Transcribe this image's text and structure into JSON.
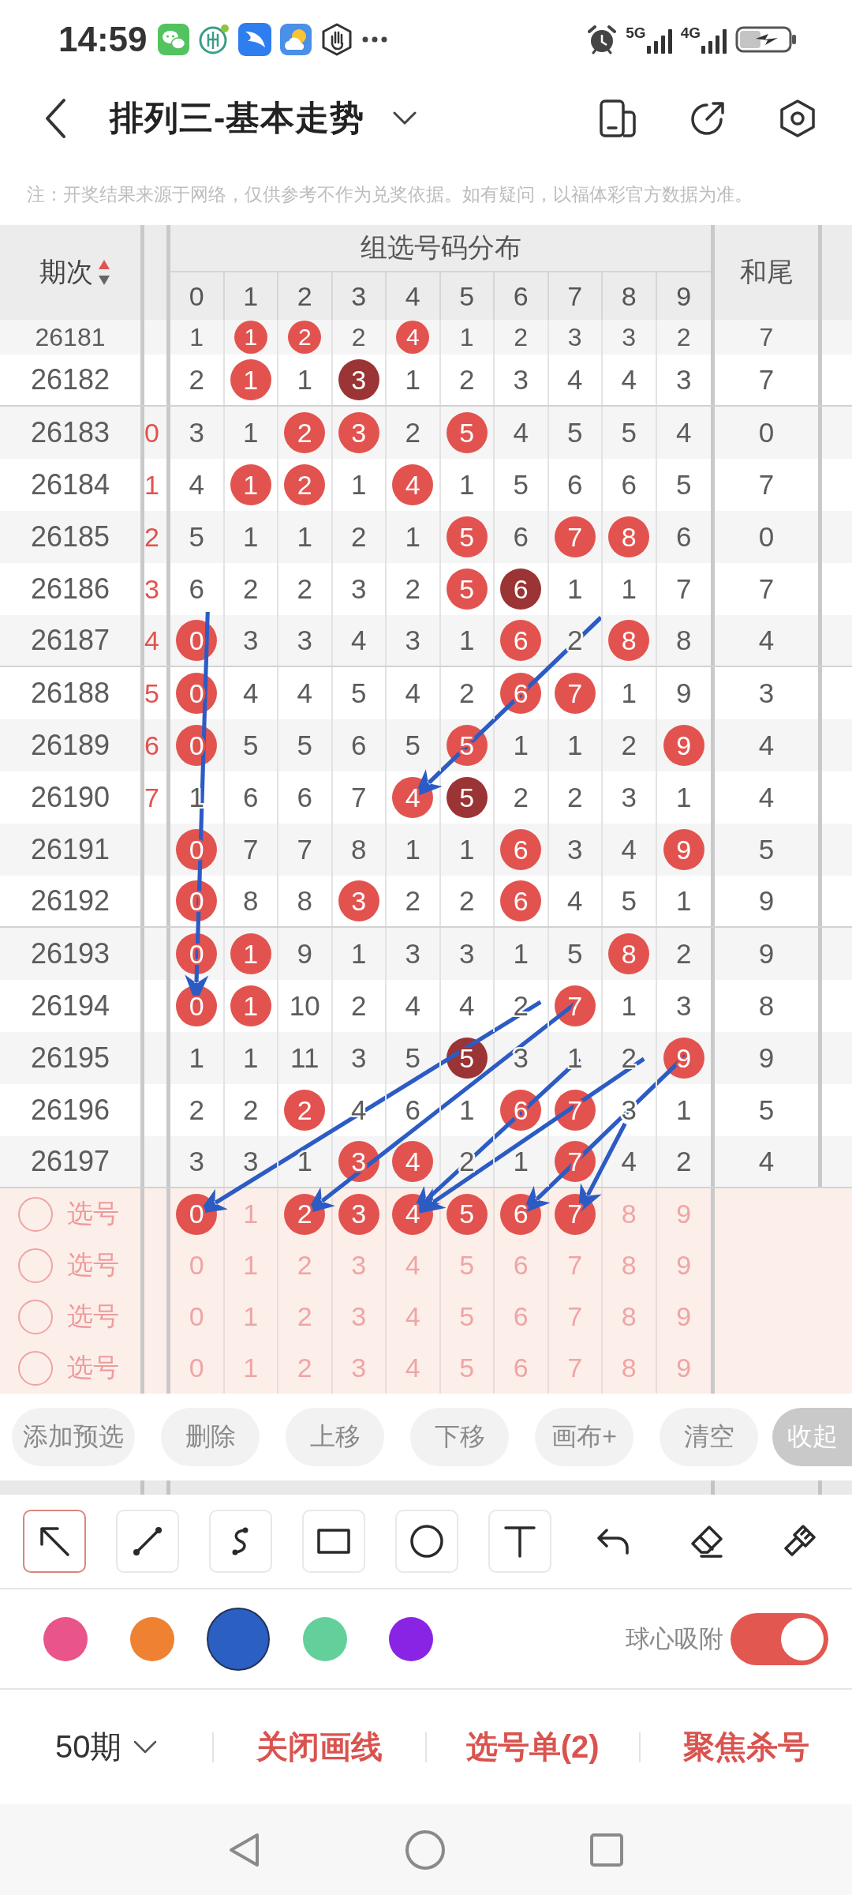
{
  "status_bar": {
    "time": "14:59",
    "networks": [
      "5G",
      "4G"
    ]
  },
  "header": {
    "title": "排列三-基本走势"
  },
  "notice": "注：开奖结果来源于网络，仅供参考不作为兑奖依据。如有疑问，以福体彩官方数据为准。",
  "table": {
    "period_header": "期次",
    "sort_ascending": true,
    "group_header": "组选号码分布",
    "digit_headers": [
      "0",
      "1",
      "2",
      "3",
      "4",
      "5",
      "6",
      "7",
      "8",
      "9"
    ],
    "tail_header": "和尾",
    "rows": [
      {
        "period": "26181",
        "cells": [
          {
            "text": "1",
            "kind": "plain"
          },
          {
            "text": "1",
            "kind": "ball"
          },
          {
            "text": "2",
            "kind": "ball"
          },
          {
            "text": "2",
            "kind": "plain"
          },
          {
            "text": "4",
            "kind": "ball"
          },
          {
            "text": "1",
            "kind": "plain"
          },
          {
            "text": "2",
            "kind": "plain"
          },
          {
            "text": "3",
            "kind": "plain"
          },
          {
            "text": "3",
            "kind": "plain"
          },
          {
            "text": "2",
            "kind": "plain"
          }
        ],
        "tail": "7"
      },
      {
        "period": "26182",
        "cells": [
          {
            "text": "2",
            "kind": "plain"
          },
          {
            "text": "1",
            "kind": "ball"
          },
          {
            "text": "1",
            "kind": "plain"
          },
          {
            "text": "3",
            "kind": "repeat"
          },
          {
            "text": "1",
            "kind": "plain"
          },
          {
            "text": "2",
            "kind": "plain"
          },
          {
            "text": "3",
            "kind": "plain"
          },
          {
            "text": "4",
            "kind": "plain"
          },
          {
            "text": "4",
            "kind": "plain"
          },
          {
            "text": "3",
            "kind": "plain"
          }
        ],
        "tail": "7"
      },
      {
        "period": "26183",
        "edge": "0",
        "cells": [
          {
            "text": "3",
            "kind": "plain"
          },
          {
            "text": "1",
            "kind": "plain"
          },
          {
            "text": "2",
            "kind": "ball"
          },
          {
            "text": "3",
            "kind": "ball"
          },
          {
            "text": "2",
            "kind": "plain"
          },
          {
            "text": "5",
            "kind": "ball"
          },
          {
            "text": "4",
            "kind": "plain"
          },
          {
            "text": "5",
            "kind": "plain"
          },
          {
            "text": "5",
            "kind": "plain"
          },
          {
            "text": "4",
            "kind": "plain"
          }
        ],
        "tail": "0"
      },
      {
        "period": "26184",
        "edge": "1",
        "cells": [
          {
            "text": "4",
            "kind": "plain"
          },
          {
            "text": "1",
            "kind": "ball"
          },
          {
            "text": "2",
            "kind": "ball"
          },
          {
            "text": "1",
            "kind": "plain"
          },
          {
            "text": "4",
            "kind": "ball"
          },
          {
            "text": "1",
            "kind": "plain"
          },
          {
            "text": "5",
            "kind": "plain"
          },
          {
            "text": "6",
            "kind": "plain"
          },
          {
            "text": "6",
            "kind": "plain"
          },
          {
            "text": "5",
            "kind": "plain"
          }
        ],
        "tail": "7"
      },
      {
        "period": "26185",
        "edge": "2",
        "cells": [
          {
            "text": "5",
            "kind": "plain"
          },
          {
            "text": "1",
            "kind": "plain"
          },
          {
            "text": "1",
            "kind": "plain"
          },
          {
            "text": "2",
            "kind": "plain"
          },
          {
            "text": "1",
            "kind": "plain"
          },
          {
            "text": "5",
            "kind": "ball"
          },
          {
            "text": "6",
            "kind": "plain"
          },
          {
            "text": "7",
            "kind": "ball"
          },
          {
            "text": "8",
            "kind": "ball"
          },
          {
            "text": "6",
            "kind": "plain"
          }
        ],
        "tail": "0"
      },
      {
        "period": "26186",
        "edge": "3",
        "cells": [
          {
            "text": "6",
            "kind": "plain"
          },
          {
            "text": "2",
            "kind": "plain"
          },
          {
            "text": "2",
            "kind": "plain"
          },
          {
            "text": "3",
            "kind": "plain"
          },
          {
            "text": "2",
            "kind": "plain"
          },
          {
            "text": "5",
            "kind": "ball"
          },
          {
            "text": "6",
            "kind": "repeat"
          },
          {
            "text": "1",
            "kind": "plain"
          },
          {
            "text": "1",
            "kind": "plain"
          },
          {
            "text": "7",
            "kind": "plain"
          }
        ],
        "tail": "7"
      },
      {
        "period": "26187",
        "edge": "4",
        "cells": [
          {
            "text": "0",
            "kind": "ball"
          },
          {
            "text": "3",
            "kind": "plain"
          },
          {
            "text": "3",
            "kind": "plain"
          },
          {
            "text": "4",
            "kind": "plain"
          },
          {
            "text": "3",
            "kind": "plain"
          },
          {
            "text": "1",
            "kind": "plain"
          },
          {
            "text": "6",
            "kind": "ball"
          },
          {
            "text": "2",
            "kind": "plain"
          },
          {
            "text": "8",
            "kind": "ball"
          },
          {
            "text": "8",
            "kind": "plain"
          }
        ],
        "tail": "4"
      },
      {
        "period": "26188",
        "edge": "5",
        "cells": [
          {
            "text": "0",
            "kind": "ball"
          },
          {
            "text": "4",
            "kind": "plain"
          },
          {
            "text": "4",
            "kind": "plain"
          },
          {
            "text": "5",
            "kind": "plain"
          },
          {
            "text": "4",
            "kind": "plain"
          },
          {
            "text": "2",
            "kind": "plain"
          },
          {
            "text": "6",
            "kind": "ball"
          },
          {
            "text": "7",
            "kind": "ball"
          },
          {
            "text": "1",
            "kind": "plain"
          },
          {
            "text": "9",
            "kind": "plain"
          }
        ],
        "tail": "3"
      },
      {
        "period": "26189",
        "edge": "6",
        "cells": [
          {
            "text": "0",
            "kind": "ball"
          },
          {
            "text": "5",
            "kind": "plain"
          },
          {
            "text": "5",
            "kind": "plain"
          },
          {
            "text": "6",
            "kind": "plain"
          },
          {
            "text": "5",
            "kind": "plain"
          },
          {
            "text": "5",
            "kind": "ball"
          },
          {
            "text": "1",
            "kind": "plain"
          },
          {
            "text": "1",
            "kind": "plain"
          },
          {
            "text": "2",
            "kind": "plain"
          },
          {
            "text": "9",
            "kind": "ball"
          }
        ],
        "tail": "4"
      },
      {
        "period": "26190",
        "edge": "7",
        "cells": [
          {
            "text": "1",
            "kind": "plain"
          },
          {
            "text": "6",
            "kind": "plain"
          },
          {
            "text": "6",
            "kind": "plain"
          },
          {
            "text": "7",
            "kind": "plain"
          },
          {
            "text": "4",
            "kind": "ball"
          },
          {
            "text": "5",
            "kind": "repeat"
          },
          {
            "text": "2",
            "kind": "plain"
          },
          {
            "text": "2",
            "kind": "plain"
          },
          {
            "text": "3",
            "kind": "plain"
          },
          {
            "text": "1",
            "kind": "plain"
          }
        ],
        "tail": "4"
      },
      {
        "period": "26191",
        "cells": [
          {
            "text": "0",
            "kind": "ball"
          },
          {
            "text": "7",
            "kind": "plain"
          },
          {
            "text": "7",
            "kind": "plain"
          },
          {
            "text": "8",
            "kind": "plain"
          },
          {
            "text": "1",
            "kind": "plain"
          },
          {
            "text": "1",
            "kind": "plain"
          },
          {
            "text": "6",
            "kind": "ball"
          },
          {
            "text": "3",
            "kind": "plain"
          },
          {
            "text": "4",
            "kind": "plain"
          },
          {
            "text": "9",
            "kind": "ball"
          }
        ],
        "tail": "5"
      },
      {
        "period": "26192",
        "cells": [
          {
            "text": "0",
            "kind": "ball"
          },
          {
            "text": "8",
            "kind": "plain"
          },
          {
            "text": "8",
            "kind": "plain"
          },
          {
            "text": "3",
            "kind": "ball"
          },
          {
            "text": "2",
            "kind": "plain"
          },
          {
            "text": "2",
            "kind": "plain"
          },
          {
            "text": "6",
            "kind": "ball"
          },
          {
            "text": "4",
            "kind": "plain"
          },
          {
            "text": "5",
            "kind": "plain"
          },
          {
            "text": "1",
            "kind": "plain"
          }
        ],
        "tail": "9"
      },
      {
        "period": "26193",
        "cells": [
          {
            "text": "0",
            "kind": "ball"
          },
          {
            "text": "1",
            "kind": "ball"
          },
          {
            "text": "9",
            "kind": "plain"
          },
          {
            "text": "1",
            "kind": "plain"
          },
          {
            "text": "3",
            "kind": "plain"
          },
          {
            "text": "3",
            "kind": "plain"
          },
          {
            "text": "1",
            "kind": "plain"
          },
          {
            "text": "5",
            "kind": "plain"
          },
          {
            "text": "8",
            "kind": "ball"
          },
          {
            "text": "2",
            "kind": "plain"
          }
        ],
        "tail": "9"
      },
      {
        "period": "26194",
        "cells": [
          {
            "text": "0",
            "kind": "ball"
          },
          {
            "text": "1",
            "kind": "ball"
          },
          {
            "text": "10",
            "kind": "plain"
          },
          {
            "text": "2",
            "kind": "plain"
          },
          {
            "text": "4",
            "kind": "plain"
          },
          {
            "text": "4",
            "kind": "plain"
          },
          {
            "text": "2",
            "kind": "plain"
          },
          {
            "text": "7",
            "kind": "ball"
          },
          {
            "text": "1",
            "kind": "plain"
          },
          {
            "text": "3",
            "kind": "plain"
          }
        ],
        "tail": "8"
      },
      {
        "period": "26195",
        "cells": [
          {
            "text": "1",
            "kind": "plain"
          },
          {
            "text": "1",
            "kind": "plain"
          },
          {
            "text": "11",
            "kind": "plain"
          },
          {
            "text": "3",
            "kind": "plain"
          },
          {
            "text": "5",
            "kind": "plain"
          },
          {
            "text": "5",
            "kind": "repeat"
          },
          {
            "text": "3",
            "kind": "plain"
          },
          {
            "text": "1",
            "kind": "plain"
          },
          {
            "text": "2",
            "kind": "plain"
          },
          {
            "text": "9",
            "kind": "ball"
          }
        ],
        "tail": "9"
      },
      {
        "period": "26196",
        "cells": [
          {
            "text": "2",
            "kind": "plain"
          },
          {
            "text": "2",
            "kind": "plain"
          },
          {
            "text": "2",
            "kind": "ball"
          },
          {
            "text": "4",
            "kind": "plain"
          },
          {
            "text": "6",
            "kind": "plain"
          },
          {
            "text": "1",
            "kind": "plain"
          },
          {
            "text": "6",
            "kind": "ball"
          },
          {
            "text": "7",
            "kind": "ball"
          },
          {
            "text": "3",
            "kind": "plain"
          },
          {
            "text": "1",
            "kind": "plain"
          }
        ],
        "tail": "5"
      },
      {
        "period": "26197",
        "cells": [
          {
            "text": "3",
            "kind": "plain"
          },
          {
            "text": "3",
            "kind": "plain"
          },
          {
            "text": "1",
            "kind": "plain"
          },
          {
            "text": "3",
            "kind": "ball"
          },
          {
            "text": "4",
            "kind": "ball"
          },
          {
            "text": "2",
            "kind": "plain"
          },
          {
            "text": "1",
            "kind": "plain"
          },
          {
            "text": "7",
            "kind": "ball"
          },
          {
            "text": "4",
            "kind": "plain"
          },
          {
            "text": "2",
            "kind": "plain"
          }
        ],
        "tail": "4"
      }
    ]
  },
  "pick_rows": [
    {
      "label": "选号",
      "checked": false,
      "digits": [
        {
          "text": "0",
          "selected": true
        },
        {
          "text": "1",
          "selected": false
        },
        {
          "text": "2",
          "selected": true
        },
        {
          "text": "3",
          "selected": true
        },
        {
          "text": "4",
          "selected": true
        },
        {
          "text": "5",
          "selected": true
        },
        {
          "text": "6",
          "selected": true
        },
        {
          "text": "7",
          "selected": true
        },
        {
          "text": "8",
          "selected": false
        },
        {
          "text": "9",
          "selected": false
        }
      ]
    },
    {
      "label": "选号",
      "checked": false,
      "digits": [
        {
          "text": "0",
          "selected": false
        },
        {
          "text": "1",
          "selected": false
        },
        {
          "text": "2",
          "selected": false
        },
        {
          "text": "3",
          "selected": false
        },
        {
          "text": "4",
          "selected": false
        },
        {
          "text": "5",
          "selected": false
        },
        {
          "text": "6",
          "selected": false
        },
        {
          "text": "7",
          "selected": false
        },
        {
          "text": "8",
          "selected": false
        },
        {
          "text": "9",
          "selected": false
        }
      ]
    },
    {
      "label": "选号",
      "checked": false,
      "digits": [
        {
          "text": "0",
          "selected": false
        },
        {
          "text": "1",
          "selected": false
        },
        {
          "text": "2",
          "selected": false
        },
        {
          "text": "3",
          "selected": false
        },
        {
          "text": "4",
          "selected": false
        },
        {
          "text": "5",
          "selected": false
        },
        {
          "text": "6",
          "selected": false
        },
        {
          "text": "7",
          "selected": false
        },
        {
          "text": "8",
          "selected": false
        },
        {
          "text": "9",
          "selected": false
        }
      ]
    },
    {
      "label": "选号",
      "checked": false,
      "digits": [
        {
          "text": "0",
          "selected": false
        },
        {
          "text": "1",
          "selected": false
        },
        {
          "text": "2",
          "selected": false
        },
        {
          "text": "3",
          "selected": false
        },
        {
          "text": "4",
          "selected": false
        },
        {
          "text": "5",
          "selected": false
        },
        {
          "text": "6",
          "selected": false
        },
        {
          "text": "7",
          "selected": false
        },
        {
          "text": "8",
          "selected": false
        },
        {
          "text": "9",
          "selected": false
        }
      ]
    }
  ],
  "actions": [
    {
      "label": "添加预选",
      "kind": "normal"
    },
    {
      "label": "删除",
      "kind": "normal"
    },
    {
      "label": "上移",
      "kind": "normal"
    },
    {
      "label": "下移",
      "kind": "normal"
    },
    {
      "label": "画布+",
      "kind": "normal"
    },
    {
      "label": "清空",
      "kind": "normal"
    },
    {
      "label": "收起",
      "kind": "collapse"
    }
  ],
  "tools": [
    {
      "kind": "pointer",
      "selected": true
    },
    {
      "kind": "line",
      "selected": false
    },
    {
      "kind": "curve",
      "selected": false
    },
    {
      "kind": "rectangle",
      "selected": false
    },
    {
      "kind": "ellipse",
      "selected": false
    },
    {
      "kind": "text",
      "selected": false
    },
    {
      "kind": "undo",
      "selected": false
    },
    {
      "kind": "eraser",
      "selected": false
    },
    {
      "kind": "brush",
      "selected": false
    }
  ],
  "colors": [
    {
      "color": "#e9548a",
      "selected": false
    },
    {
      "color": "#ee8232",
      "selected": false
    },
    {
      "color": "#2b5fc2",
      "selected": true
    },
    {
      "color": "#63d09b",
      "selected": false
    },
    {
      "color": "#8a24e4",
      "selected": false
    }
  ],
  "snap": {
    "label": "球心吸附",
    "on": true
  },
  "footer": {
    "period_select": "50期",
    "actions": [
      "关闭画线",
      "选号单(2)",
      "聚焦杀号"
    ]
  }
}
